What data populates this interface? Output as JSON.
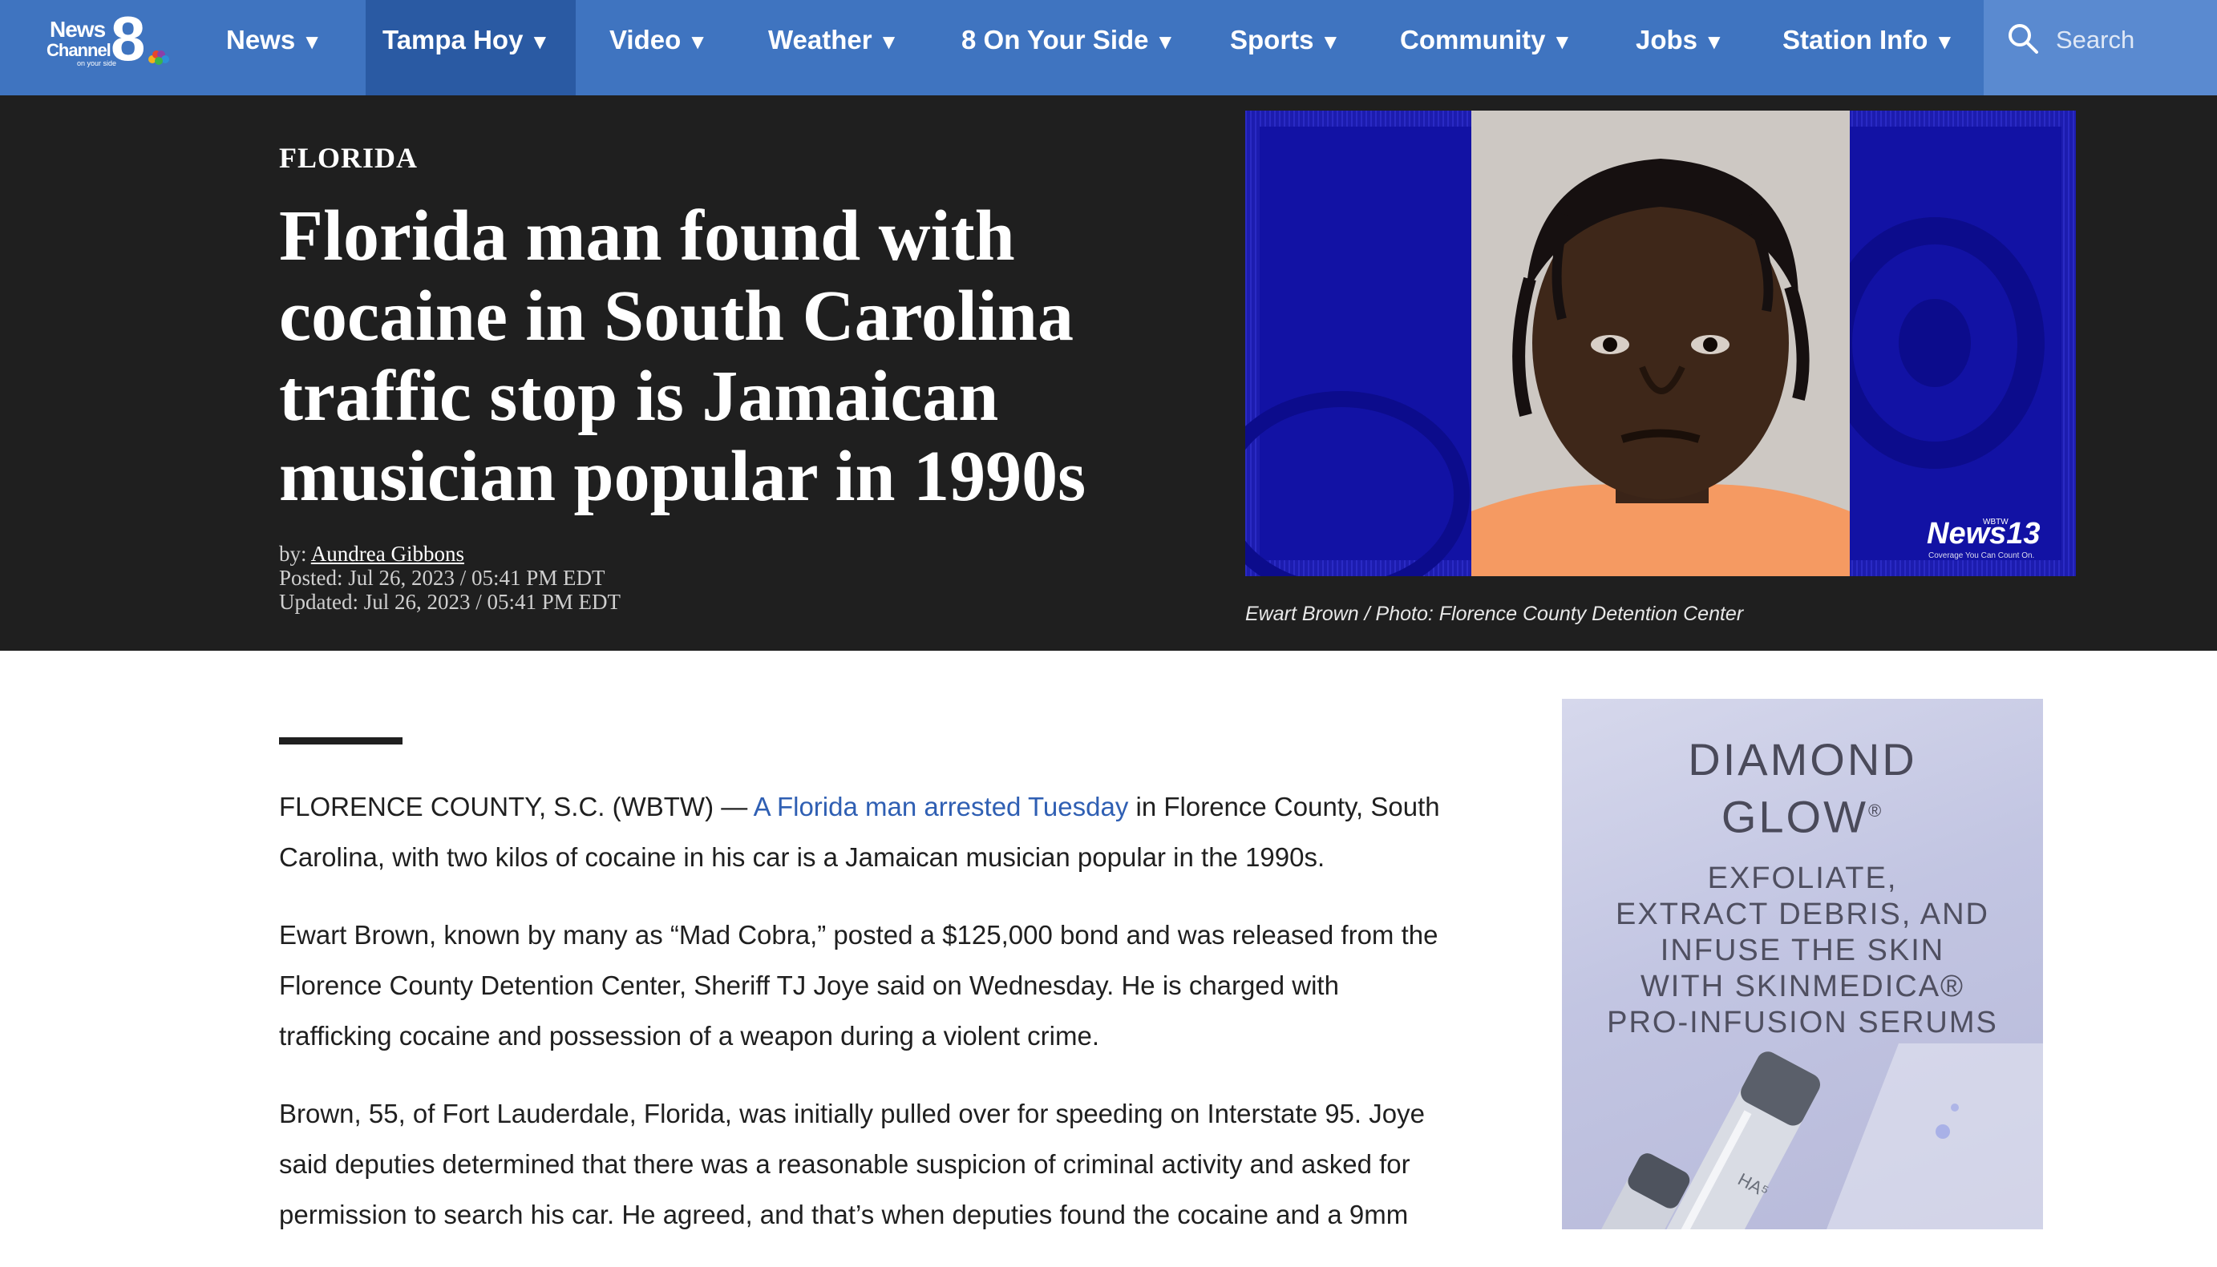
{
  "nav": {
    "logo": {
      "line1": "News",
      "line2": "Channel",
      "digit": "8",
      "tagline": "on your side"
    },
    "items": [
      {
        "label": "News",
        "caret": "▼"
      },
      {
        "label": "Tampa Hoy",
        "caret": "▼"
      },
      {
        "label": "Video",
        "caret": "▼"
      },
      {
        "label": "Weather",
        "caret": "▼"
      },
      {
        "label": "8 On Your Side",
        "caret": "▼"
      },
      {
        "label": "Sports",
        "caret": "▼"
      },
      {
        "label": "Community",
        "caret": "▼"
      },
      {
        "label": "Jobs",
        "caret": "▼"
      },
      {
        "label": "Station Info",
        "caret": "▼"
      }
    ],
    "active_item": "Tampa Hoy",
    "search_placeholder": "Search"
  },
  "hero": {
    "section": "FLORIDA",
    "headline": "Florida man found with cocaine in South Carolina traffic stop is Jamaican musician popular in 1990s",
    "byline_prefix": "by:",
    "author": "Aundrea Gibbons",
    "posted": "Posted: Jul 26, 2023 / 05:41 PM EDT",
    "updated": "Updated: Jul 26, 2023 / 05:41 PM EDT",
    "photo_watermark": "News13",
    "photo_watermark_small": "WBTW",
    "photo_watermark_tagline": "Coverage You Can Count On.",
    "caption": "Ewart Brown / Photo: Florence County Detention Center"
  },
  "article": {
    "p1_lead": "FLORENCE COUNTY, S.C. (WBTW) — ",
    "p1_link": "A Florida man arrested Tuesday",
    "p1_rest": " in Florence County, South Carolina, with two kilos of cocaine in his car is a Jamaican musician popular in the 1990s.",
    "p2": "Ewart Brown, known by many as “Mad Cobra,” posted a $125,000 bond and was released from the Florence County Detention Center, Sheriff TJ Joye said on Wednesday. He is charged with trafficking cocaine and possession of a weapon during a violent crime.",
    "p3": "Brown, 55, of Fort Lauderdale, Florida, was initially pulled over for speeding on Interstate 95. Joye said deputies determined that there was a reasonable suspicion of criminal activity and asked for permission to search his car. He agreed, and that’s when deputies found the cocaine and a 9mm"
  },
  "ad": {
    "title_line1": "DIAMOND",
    "title_line2": "GLOW",
    "title_mark": "®",
    "copy_lines": [
      "EXFOLIATE,",
      "EXTRACT DEBRIS, AND",
      "INFUSE THE SKIN",
      "WITH SKINMEDICA®",
      "PRO-INFUSION SERUMS"
    ],
    "bottle_text": "HA⁵"
  },
  "colors": {
    "nav_bg": "#3f74c0",
    "nav_active_bg": "#2a5aa3",
    "search_bg": "#5a8ad0",
    "hero_bg": "#1f1f1f",
    "link": "#2f5fb3"
  },
  "icons": [
    "search-icon",
    "caret-down-icon",
    "channel-8-logo"
  ]
}
